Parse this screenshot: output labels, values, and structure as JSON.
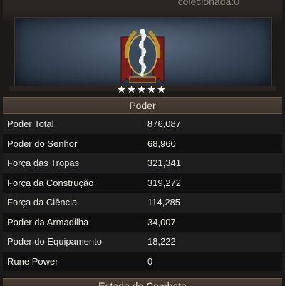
{
  "top_banner": {
    "title_fragment": "colecionada:0"
  },
  "emblem": {
    "icon": "serpent-staff-emblem-icon",
    "stars": 5
  },
  "power_section": {
    "header": "Poder",
    "rows": [
      {
        "label": "Poder Total",
        "value": "876,087"
      },
      {
        "label": "Poder do Senhor",
        "value": "68,960"
      },
      {
        "label": "Força das Tropas",
        "value": "321,341"
      },
      {
        "label": "Força da Construção",
        "value": "319,272"
      },
      {
        "label": "Força da Ciência",
        "value": "114,285"
      },
      {
        "label": "Poder da Armadilha",
        "value": "34,007"
      },
      {
        "label": "Poder do Equipamento",
        "value": "18,222"
      },
      {
        "label": "Rune Power",
        "value": "0"
      }
    ]
  },
  "combat_section": {
    "header": "Estado de Combate"
  },
  "colors": {
    "background": "#1b1a19",
    "header_bg": "#4a4038",
    "text": "#eae6e0"
  }
}
